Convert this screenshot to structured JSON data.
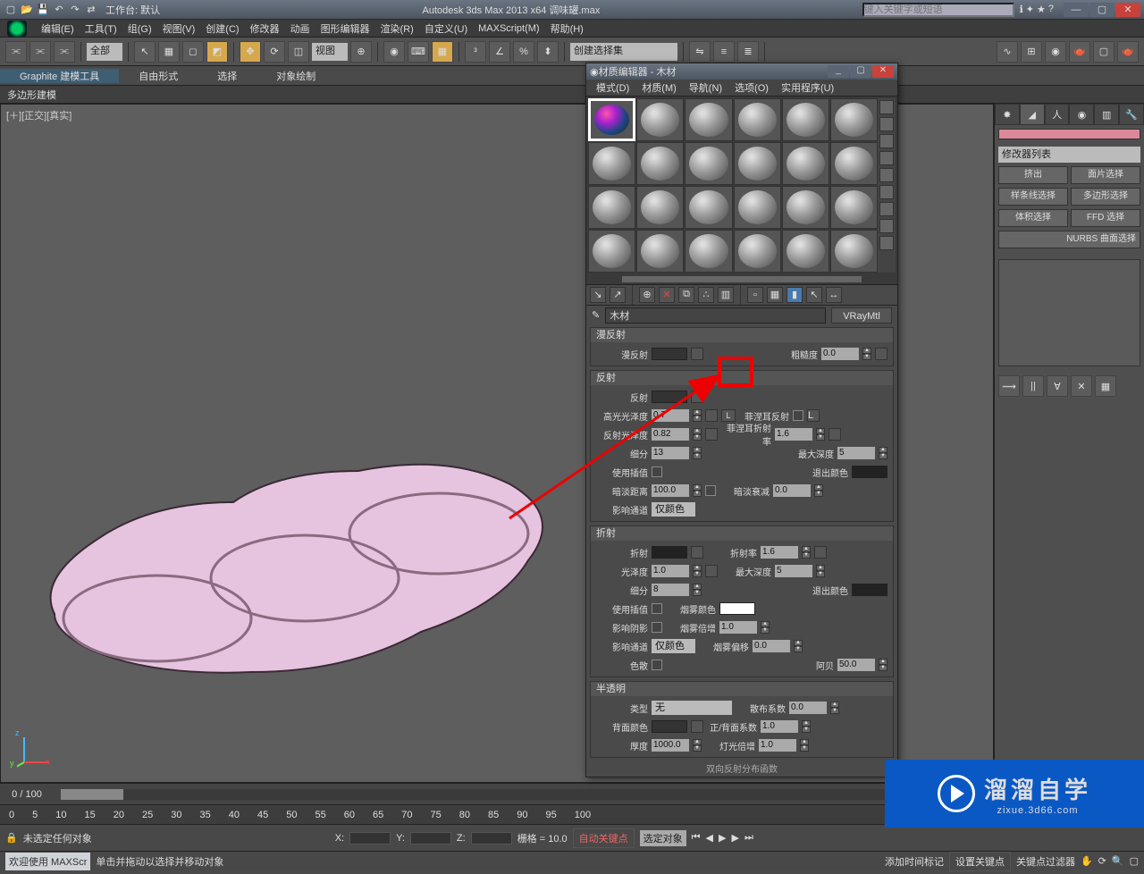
{
  "titlebar": {
    "workspace": "工作台: 默认",
    "title": "Autodesk 3ds Max  2013 x64     调味罐.max",
    "search_placeholder": "键入关键字或短语"
  },
  "menus": [
    "编辑(E)",
    "工具(T)",
    "组(G)",
    "视图(V)",
    "创建(C)",
    "修改器",
    "动画",
    "图形编辑器",
    "渲染(R)",
    "自定义(U)",
    "MAXScript(M)",
    "帮助(H)"
  ],
  "toolbar": {
    "filter": "全部",
    "view": "视图",
    "create_set": "创建选择集"
  },
  "ribbon": {
    "tabs": [
      "Graphite 建模工具",
      "自由形式",
      "选择",
      "对象绘制"
    ],
    "sub": "多边形建模"
  },
  "viewport": {
    "label": "[＋][正交][真实]"
  },
  "cmdpanel": {
    "modlist": "修改器列表",
    "buttons": [
      "挤出",
      "面片选择",
      "样条线选择",
      "多边形选择",
      "体积选择",
      "FFD 选择"
    ],
    "nurbs": "NURBS 曲面选择"
  },
  "matEditor": {
    "title": "材质编辑器 - 木材",
    "menus": [
      "模式(D)",
      "材质(M)",
      "导航(N)",
      "选项(O)",
      "实用程序(U)"
    ],
    "matName": "木材",
    "matType": "VRayMtl",
    "diffuse": {
      "header": "漫反射",
      "label": "漫反射",
      "rough_label": "粗糙度",
      "rough": "0.0"
    },
    "reflect": {
      "header": "反射",
      "label": "反射",
      "hgloss_label": "高光光泽度",
      "hgloss": "0.7",
      "lock": "L",
      "rgloss_label": "反射光泽度",
      "rgloss": "0.82",
      "subdiv_label": "细分",
      "subdiv": "13",
      "interp_label": "使用插值",
      "dim_label": "暗淡距离",
      "dim": "100.0",
      "affect_label": "影响通道",
      "affect": "仅颜色",
      "fresnel_label": "菲涅耳反射",
      "fior_label": "菲涅耳折射率",
      "fior": "1.6",
      "maxd_label": "最大深度",
      "maxd": "5",
      "exit_label": "退出颜色",
      "dimf_label": "暗淡衰减",
      "dimf": "0.0"
    },
    "refract": {
      "header": "折射",
      "label": "折射",
      "gloss_label": "光泽度",
      "gloss": "1.0",
      "subdiv_label": "细分",
      "subdiv": "8",
      "interp_label": "使用插值",
      "shadow_label": "影响阴影",
      "affect_label": "影响通道",
      "affect": "仅颜色",
      "disp_label": "色散",
      "ior_label": "折射率",
      "ior": "1.6",
      "maxd_label": "最大深度",
      "maxd": "5",
      "exit_label": "退出颜色",
      "fog_label": "烟雾颜色",
      "fogm_label": "烟雾倍增",
      "fogm": "1.0",
      "fogb_label": "烟雾偏移",
      "fogb": "0.0",
      "abbe_label": "阿贝",
      "abbe": "50.0"
    },
    "trans": {
      "header": "半透明",
      "type_label": "类型",
      "type": "无",
      "back_label": "背面颜色",
      "thick_label": "厚度",
      "thick": "1000.0",
      "scatter_label": "散布系数",
      "scatter": "0.0",
      "fb_label": "正/背面系数",
      "fb": "1.0",
      "light_label": "灯光倍增",
      "light": "1.0"
    },
    "brdf": "双向反射分布函数"
  },
  "timeline": {
    "pos": "0 / 100",
    "ticks": [
      "0",
      "5",
      "10",
      "15",
      "20",
      "25",
      "30",
      "35",
      "40",
      "45",
      "50",
      "55",
      "60",
      "65",
      "70",
      "75",
      "80",
      "85",
      "90",
      "95",
      "100"
    ]
  },
  "status": {
    "none": "未选定任何对象",
    "hint": "单击并拖动以选择并移动对象",
    "grid": "栅格 = 10.0",
    "add_marker": "添加时间标记",
    "autokey": "自动关键点",
    "setkey": "设置关键点",
    "filt": "关键点过滤器",
    "selset": "选定对象"
  },
  "bottom": {
    "welcome": "欢迎使用  MAXScr"
  },
  "wm": {
    "big": "溜溜自学",
    "small": "zixue.3d66.com"
  }
}
